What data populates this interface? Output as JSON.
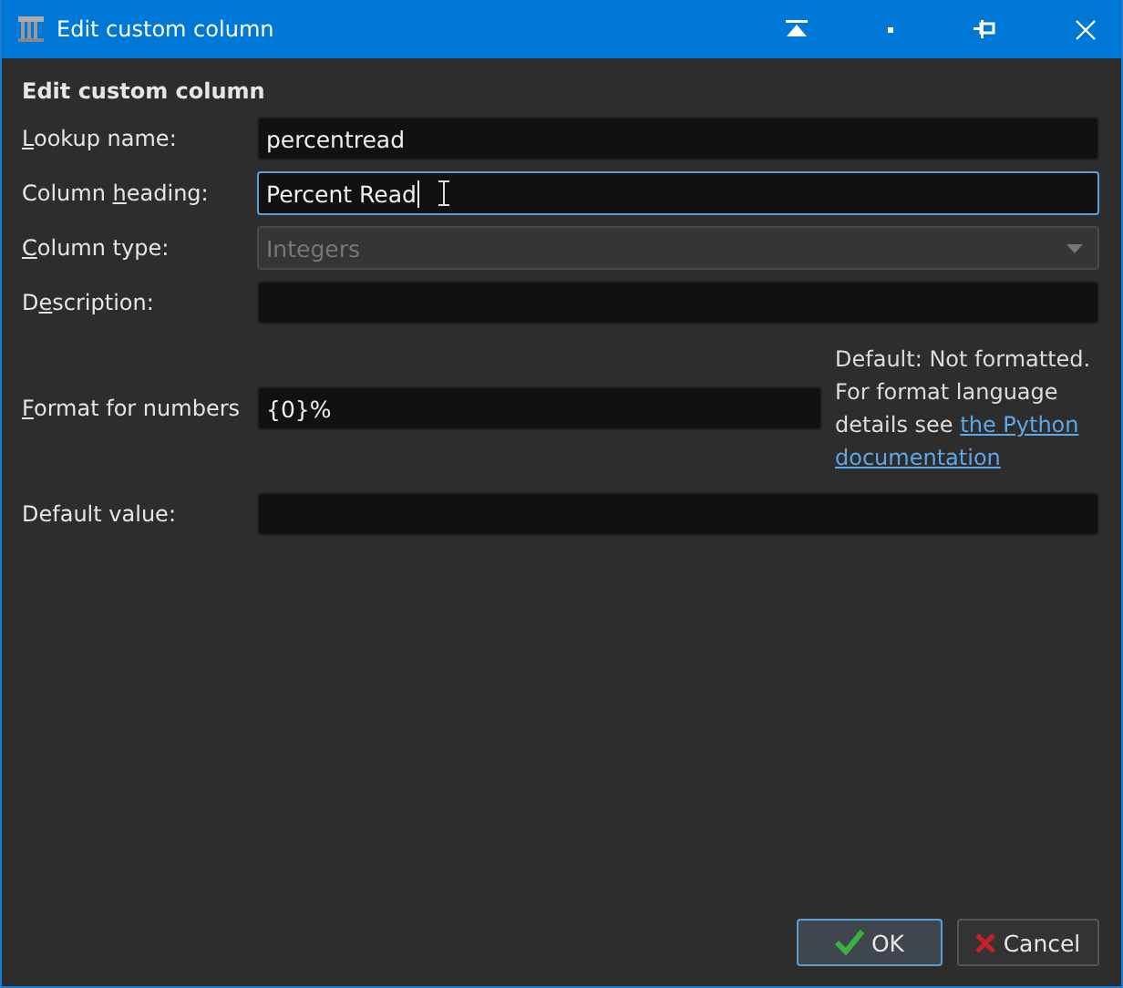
{
  "window": {
    "title": "Edit custom column"
  },
  "heading": "Edit custom column",
  "fields": [
    {
      "kind": "text",
      "access_key": "L",
      "label_after": "ookup name:",
      "value": "percentread",
      "focused": false
    },
    {
      "kind": "text",
      "label_before": "Column ",
      "access_key": "h",
      "label_after": "eading:",
      "value": "Percent Read",
      "focused": true
    },
    {
      "kind": "combo",
      "access_key": "C",
      "label_after": "olumn type:",
      "value": "Integers",
      "disabled": true
    },
    {
      "kind": "text",
      "label_before": "D",
      "access_key": "e",
      "label_after": "scription:",
      "focused": false
    },
    {
      "kind": "format",
      "access_key": "F",
      "label_after": "ormat for numbers",
      "value": "{0}%",
      "focused": false,
      "help": "Default: Not formatted. For format language details see",
      "help_link_lines": [
        "the Python",
        "documentation"
      ]
    },
    {
      "kind": "text",
      "label_before": "Default value:",
      "focused": false
    }
  ],
  "buttons": [
    {
      "kind": "ok",
      "label": "OK",
      "selected": true
    },
    {
      "kind": "cancel",
      "label": "Cancel",
      "selected": false
    }
  ]
}
